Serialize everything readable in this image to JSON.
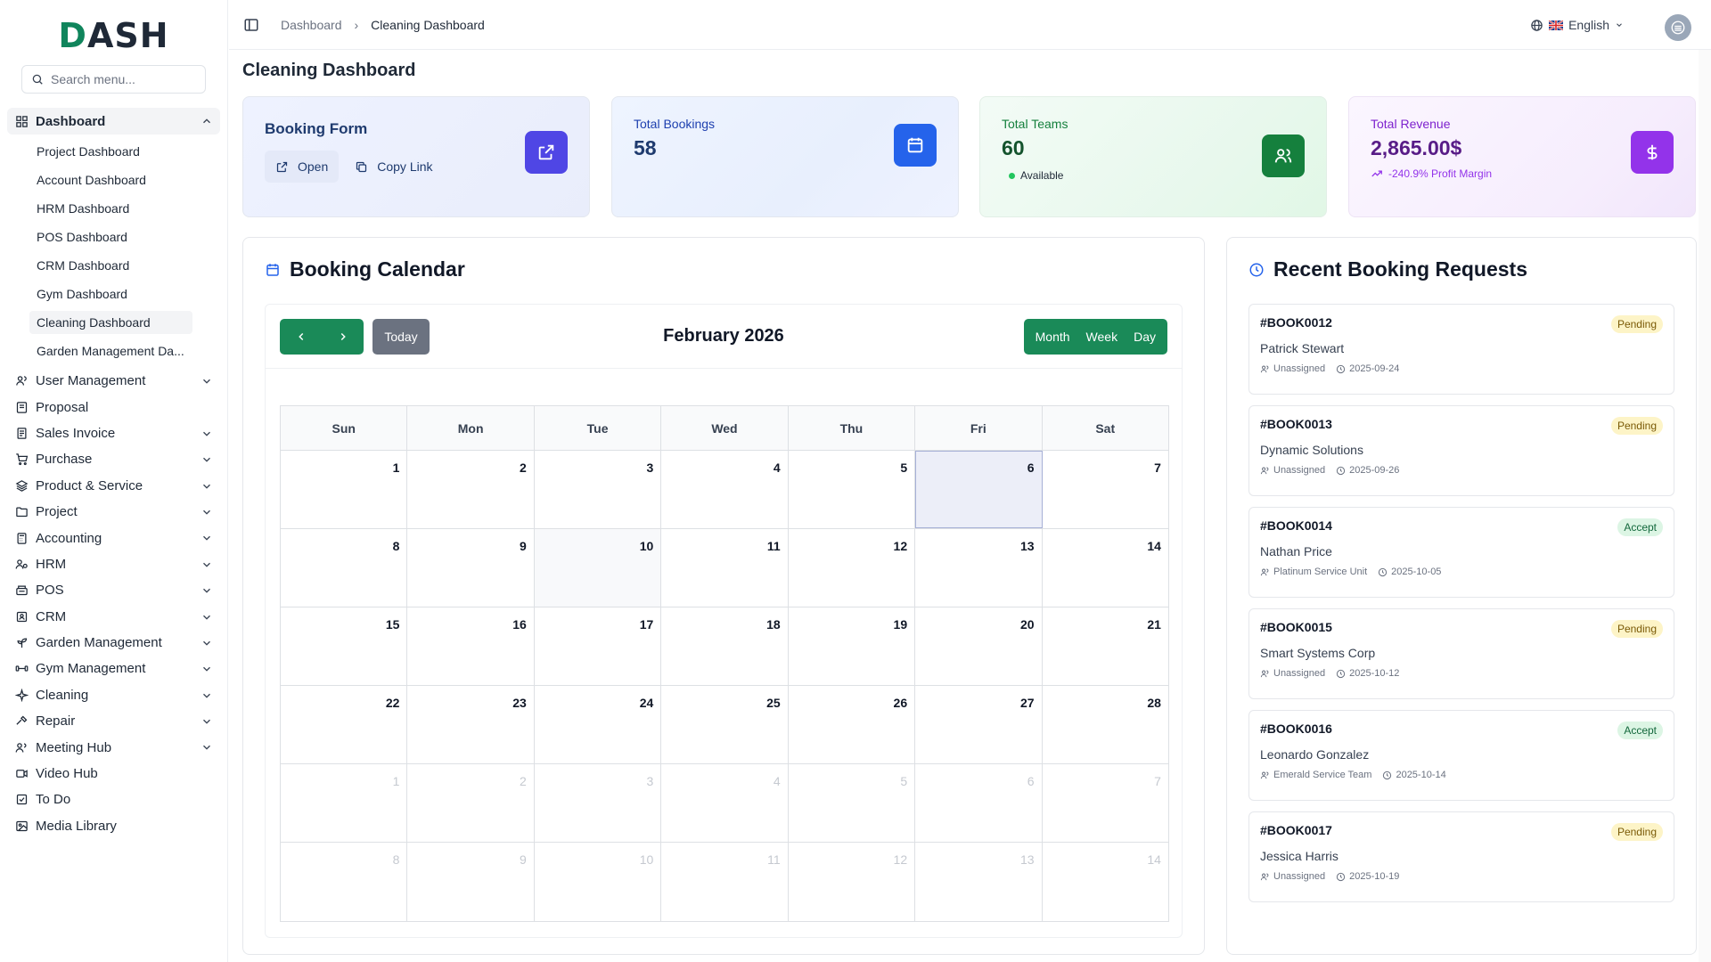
{
  "sidebar": {
    "logo": "DASH",
    "search_placeholder": "Search menu...",
    "dashboard_label": "Dashboard",
    "sub_items": [
      "Project Dashboard",
      "Account Dashboard",
      "HRM Dashboard",
      "POS Dashboard",
      "CRM Dashboard",
      "Gym Dashboard",
      "Cleaning Dashboard",
      "Garden Management Da..."
    ],
    "items": [
      {
        "label": "User Management",
        "icon": "users-icon",
        "chevron": true
      },
      {
        "label": "Proposal",
        "icon": "proposal-icon",
        "chevron": false
      },
      {
        "label": "Sales Invoice",
        "icon": "invoice-icon",
        "chevron": true
      },
      {
        "label": "Purchase",
        "icon": "cart-icon",
        "chevron": true
      },
      {
        "label": "Product & Service",
        "icon": "layers-icon",
        "chevron": true
      },
      {
        "label": "Project",
        "icon": "folder-icon",
        "chevron": true
      },
      {
        "label": "Accounting",
        "icon": "calculator-icon",
        "chevron": true
      },
      {
        "label": "HRM",
        "icon": "hrm-icon",
        "chevron": true
      },
      {
        "label": "POS",
        "icon": "pos-icon",
        "chevron": true
      },
      {
        "label": "CRM",
        "icon": "crm-icon",
        "chevron": true
      },
      {
        "label": "Garden Management",
        "icon": "sprout-icon",
        "chevron": true
      },
      {
        "label": "Gym Management",
        "icon": "dumbbell-icon",
        "chevron": true
      },
      {
        "label": "Cleaning",
        "icon": "sparkle-icon",
        "chevron": true
      },
      {
        "label": "Repair",
        "icon": "hammer-icon",
        "chevron": true
      },
      {
        "label": "Meeting Hub",
        "icon": "meeting-icon",
        "chevron": true
      },
      {
        "label": "Video Hub",
        "icon": "video-icon",
        "chevron": false
      },
      {
        "label": "To Do",
        "icon": "checkbox-icon",
        "chevron": false
      },
      {
        "label": "Media Library",
        "icon": "image-icon",
        "chevron": false
      }
    ]
  },
  "header": {
    "breadcrumb": [
      "Dashboard",
      "Cleaning Dashboard"
    ],
    "language": "English"
  },
  "page_title": "Cleaning Dashboard",
  "cards": {
    "booking_form": {
      "title": "Booking Form",
      "open": "Open",
      "copy": "Copy Link"
    },
    "total_bookings": {
      "label": "Total Bookings",
      "value": "58"
    },
    "total_teams": {
      "label": "Total Teams",
      "value": "60",
      "status": "Available"
    },
    "total_revenue": {
      "label": "Total Revenue",
      "value": "2,865.00$",
      "margin": "-240.9% Profit Margin"
    }
  },
  "calendar": {
    "title": "Booking Calendar",
    "today": "Today",
    "month": "February 2026",
    "views": [
      "Month",
      "Week",
      "Day"
    ],
    "weekdays": [
      "Sun",
      "Mon",
      "Tue",
      "Wed",
      "Thu",
      "Fri",
      "Sat"
    ],
    "weeks": [
      [
        "1",
        "2",
        "3",
        "4",
        "5",
        "6",
        "7"
      ],
      [
        "8",
        "9",
        "10",
        "11",
        "12",
        "13",
        "14"
      ],
      [
        "15",
        "16",
        "17",
        "18",
        "19",
        "20",
        "21"
      ],
      [
        "22",
        "23",
        "24",
        "25",
        "26",
        "27",
        "28"
      ],
      [
        "1",
        "2",
        "3",
        "4",
        "5",
        "6",
        "7"
      ],
      [
        "8",
        "9",
        "10",
        "11",
        "12",
        "13",
        "14"
      ]
    ]
  },
  "requests": {
    "title": "Recent Booking Requests",
    "items": [
      {
        "id": "#BOOK0012",
        "name": "Patrick Stewart",
        "team": "Unassigned",
        "date": "2025-09-24",
        "status": "Pending"
      },
      {
        "id": "#BOOK0013",
        "name": "Dynamic Solutions",
        "team": "Unassigned",
        "date": "2025-09-26",
        "status": "Pending"
      },
      {
        "id": "#BOOK0014",
        "name": "Nathan Price",
        "team": "Platinum Service Unit",
        "date": "2025-10-05",
        "status": "Accept"
      },
      {
        "id": "#BOOK0015",
        "name": "Smart Systems Corp",
        "team": "Unassigned",
        "date": "2025-10-12",
        "status": "Pending"
      },
      {
        "id": "#BOOK0016",
        "name": "Leonardo Gonzalez",
        "team": "Emerald Service Team",
        "date": "2025-10-14",
        "status": "Accept"
      },
      {
        "id": "#BOOK0017",
        "name": "Jessica Harris",
        "team": "Unassigned",
        "date": "2025-10-19",
        "status": "Pending"
      }
    ]
  }
}
